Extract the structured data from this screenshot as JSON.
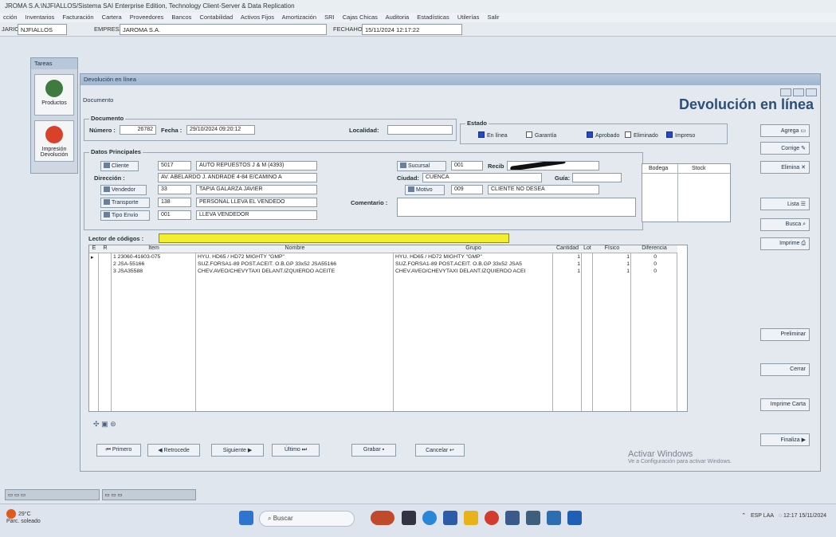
{
  "app_title": "JROMA S.A.\\NJFIALLOS/Sistema SAI Enterprise Edition, Technology Client-Server & Data Replication",
  "menu": [
    "cción",
    "Inventarios",
    "Facturación",
    "Cartera",
    "Proveedores",
    "Bancos",
    "Contabilidad",
    "Activos Fijos",
    "Amortización",
    "SRI",
    "Cajas Chicas",
    "Auditoria",
    "Estadísticas",
    "Utilerías",
    "Salir"
  ],
  "infobar": {
    "usuario_label": "JARIO",
    "usuario": "NJFIALLOS",
    "empresa_label": "EMPRESA",
    "empresa": "JAROMA S.A.",
    "fechahora_label": "FECHAHORA",
    "fechahora": "15/11/2024 12:17:22"
  },
  "left_panel": {
    "title": "Tareas",
    "items": [
      "Productos",
      "Impresión Devolución"
    ]
  },
  "window": {
    "title": "Devolución en línea",
    "tab": "Documento",
    "big_title": "Devolución en línea"
  },
  "documento": {
    "legend": "Documento",
    "numero_label": "Número :",
    "numero": "26782",
    "fecha_label": "Fecha :",
    "fecha": "29/10/2024 09:20:12",
    "localidad_label": "Localidad:",
    "localidad": ""
  },
  "estado": {
    "legend": "Estado",
    "options": [
      {
        "label": "En línea",
        "checked": true
      },
      {
        "label": "Garantía",
        "checked": false
      },
      {
        "label": "Aprobado",
        "checked": true
      },
      {
        "label": "Eliminado",
        "checked": false
      },
      {
        "label": "Impreso",
        "checked": true
      }
    ]
  },
  "datos": {
    "legend": "Datos Principales",
    "cliente_btn": "Cliente",
    "cliente_code": "5017",
    "cliente_name": "AUTO REPUESTOS J & M (4393)",
    "direccion_label": "Dirección :",
    "direccion": "AV. ABELARDO J. ANDRADE 4-84 E/CAMINO A",
    "vendedor_btn": "Vendedor",
    "vendedor_code": "33",
    "vendedor_name": "TAPIA GALARZA JAVIER",
    "transporte_btn": "Transporte",
    "transporte_code": "138",
    "transporte_name": "PERSONAL LLEVA EL VENDEDO",
    "tipoenvio_btn": "Tipo Envío",
    "tipoenvio_code": "001",
    "tipoenvio_name": "LLEVA VENDEDOR",
    "sucursal_btn": "Sucursal",
    "sucursal_code": "001",
    "recibe_label": "Recib",
    "ciudad_label": "Ciudad:",
    "ciudad": "CUENCA",
    "guia_label": "Guía:",
    "guia": "",
    "motivo_btn": "Motivo",
    "motivo_code": "009",
    "motivo_name": "CLIENTE NO DESEA",
    "comentario_label": "Comentario :"
  },
  "bodega": {
    "headers": [
      "Bodega",
      "Stock"
    ]
  },
  "lector_label": "Lector de códigos :",
  "grid": {
    "headers": [
      "E",
      "R",
      "Item",
      "Nombre",
      "Grupo",
      "Cantidad",
      "Lot",
      "Físico",
      "Diferencia"
    ],
    "rows": [
      {
        "n": "1",
        "item": "23060-41603-075",
        "nombre": "HYU. HD65 / HD72 MIGHTY \"GMP\"",
        "grupo": "HYU. HD65 / HD72 MIGHTY \"GMP\"",
        "cantidad": "1",
        "fisico": "1",
        "diferencia": "0"
      },
      {
        "n": "2",
        "item": "JSA-55166",
        "nombre": "SUZ.FORSA1-89 POST.ACEIT. O.B.GP 33x52 JSA55166",
        "grupo": "SUZ.FORSA1-89 POST.ACEIT. O.B.GP 33x52 JSA5",
        "cantidad": "1",
        "fisico": "1",
        "diferencia": "0"
      },
      {
        "n": "3",
        "item": "JSA35588",
        "nombre": "CHEV.AVEO/CHEVYTAXI DELANT.IZQUIERDO ACEITE",
        "grupo": "CHEV.AVEO/CHEVYTAXI DELANT.IZQUIERDO ACEI",
        "cantidad": "1",
        "fisico": "1",
        "diferencia": "0"
      }
    ]
  },
  "nav": [
    "Primero",
    "Retrocede",
    "Siguiente",
    "Último",
    "Grabar",
    "Cancelar"
  ],
  "side_buttons": [
    "Agrega",
    "Corrige",
    "Elimina",
    "Lista",
    "Busca",
    "Imprime",
    "Preliminar",
    "Cerrar",
    "Imprime Carta",
    "Finaliza"
  ],
  "watermark": {
    "line1": "Activar Windows",
    "line2": "Ve a Configuración para activar Windows."
  },
  "taskbar": {
    "weather_temp": "29°C",
    "weather_desc": "Parc. soleado",
    "search": "Buscar",
    "lang": "ESP",
    "lang2": "LAA",
    "time": "12:17",
    "date": "15/11/2024"
  },
  "colors": {
    "accent": "#2b4f78",
    "scanner": "#f4ef2c",
    "check": "#2348c8"
  }
}
